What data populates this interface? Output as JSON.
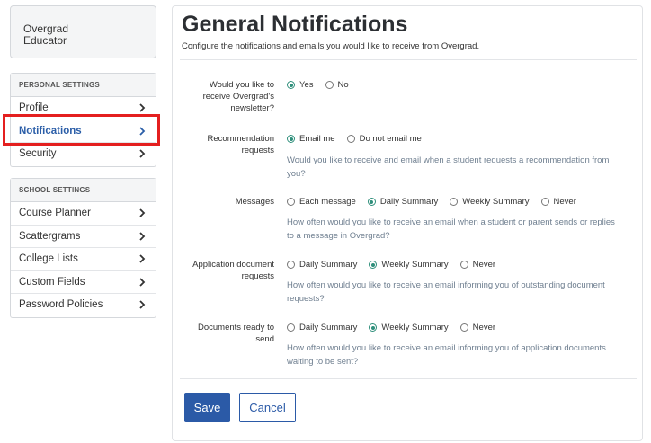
{
  "user": {
    "line1": "Overgrad",
    "line2": "Educator"
  },
  "personal_settings": {
    "heading": "PERSONAL SETTINGS",
    "items": [
      {
        "label": "Profile"
      },
      {
        "label": "Notifications",
        "active": true
      },
      {
        "label": "Security"
      }
    ]
  },
  "school_settings": {
    "heading": "SCHOOL SETTINGS",
    "items": [
      {
        "label": "Course Planner"
      },
      {
        "label": "Scattergrams"
      },
      {
        "label": "College Lists"
      },
      {
        "label": "Custom Fields"
      },
      {
        "label": "Password Policies"
      }
    ]
  },
  "main": {
    "title": "General Notifications",
    "subtitle": "Configure the notifications and emails you would like to receive from Overgrad.",
    "rows": [
      {
        "label_lines": [
          "Would you like to",
          "receive Overgrad's",
          "newsletter?"
        ],
        "options": [
          {
            "label": "Yes",
            "checked": true
          },
          {
            "label": "No",
            "checked": false
          }
        ],
        "help_lines": []
      },
      {
        "label_lines": [
          "Recommendation",
          "requests"
        ],
        "options": [
          {
            "label": "Email me",
            "checked": true
          },
          {
            "label": "Do not email me",
            "checked": false
          }
        ],
        "help_lines": [
          "Would you like to receive and email when a student requests a recommendation from",
          "you?"
        ]
      },
      {
        "label_lines": [
          "Messages"
        ],
        "options": [
          {
            "label": "Each message",
            "checked": false
          },
          {
            "label": "Daily Summary",
            "checked": true
          },
          {
            "label": "Weekly Summary",
            "checked": false
          },
          {
            "label": "Never",
            "checked": false
          }
        ],
        "help_lines": [
          "How often would you like to receive an email when a student or parent sends or replies",
          "to a message in Overgrad?"
        ]
      },
      {
        "label_lines": [
          "Application document",
          "requests"
        ],
        "options": [
          {
            "label": "Daily Summary",
            "checked": false
          },
          {
            "label": "Weekly Summary",
            "checked": true
          },
          {
            "label": "Never",
            "checked": false
          }
        ],
        "help_lines": [
          "How often would you like to receive an email informing you of outstanding document",
          "requests?"
        ]
      },
      {
        "label_lines": [
          "Documents ready to",
          "send"
        ],
        "options": [
          {
            "label": "Daily Summary",
            "checked": false
          },
          {
            "label": "Weekly Summary",
            "checked": true
          },
          {
            "label": "Never",
            "checked": false
          }
        ],
        "help_lines": [
          "How often would you like to receive an email informing you of application documents",
          "waiting to be sent?"
        ]
      }
    ],
    "save_label": "Save",
    "cancel_label": "Cancel"
  },
  "colors": {
    "accent": "#2b5aa7",
    "radio_checked": "#2f8f7b",
    "highlight": "#e41f1f",
    "help_text": "#6f7f90"
  }
}
